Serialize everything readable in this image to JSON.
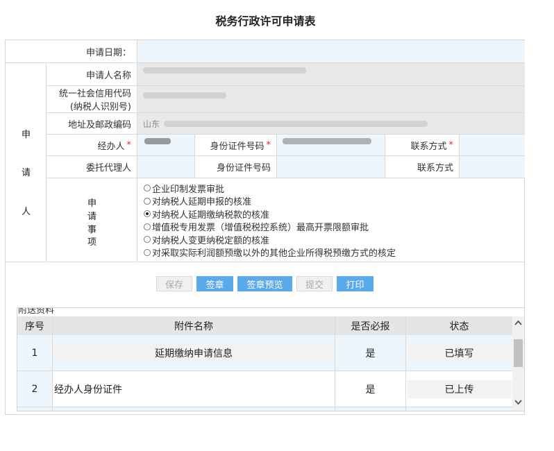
{
  "title": "税务行政许可申请表",
  "form": {
    "apply_date_label": "申请日期：",
    "applicant_side_label": [
      "申",
      "请",
      "人"
    ],
    "rows": {
      "name_label": "申请人名称",
      "credit_code_label_1": "统一社会信用代码",
      "credit_code_label_2": "(纳税人识别号)",
      "address_label": "地址及邮政编码",
      "address_prefix": "山东",
      "agent_label": "经办人",
      "agent_id_label": "身份证件号码",
      "agent_contact_label": "联系方式",
      "proxy_label": "委托代理人",
      "proxy_id_label": "身份证件号码",
      "proxy_contact_label": "联系方式",
      "required_mark": "*"
    },
    "matter_label": [
      "申",
      "请",
      "事",
      "项"
    ],
    "options": [
      {
        "label": "企业印制发票审批",
        "selected": false
      },
      {
        "label": "对纳税人延期申报的核准",
        "selected": false
      },
      {
        "label": "对纳税人延期缴纳税款的核准",
        "selected": true
      },
      {
        "label": "增值税专用发票（增值税税控系统）最高开票限额审批",
        "selected": false
      },
      {
        "label": "对纳税人变更纳税定额的核准",
        "selected": false
      },
      {
        "label": "对采取实际利润额预缴以外的其他企业所得税预缴方式的核定",
        "selected": false
      }
    ]
  },
  "buttons": {
    "save": "保存",
    "sign": "签章",
    "sign_preview": "签章预览",
    "submit": "提交",
    "print": "打印"
  },
  "attachments": {
    "title": "附送资料",
    "headers": {
      "index": "序号",
      "name": "附件名称",
      "required": "是否必报",
      "status": "状态"
    },
    "rows": [
      {
        "index": "1",
        "name": "延期缴纳申请信息",
        "required": "是",
        "status": "已填写"
      },
      {
        "index": "2",
        "name": "经办人身份证件",
        "required": "是",
        "status": "已上传"
      }
    ]
  },
  "scrollbar": {
    "up_icon": "chevron-up-icon",
    "down_icon": "chevron-down-icon"
  },
  "colors": {
    "accent": "#5aa9ea",
    "required": "#e0262e",
    "input_bg": "#eef6fd"
  }
}
